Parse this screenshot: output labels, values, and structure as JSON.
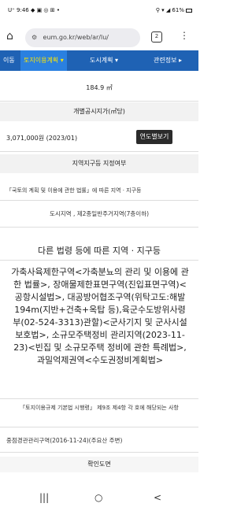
{
  "status": {
    "left": "U⁺ 9:46 ◆ ▣ ◎ ⊞ •",
    "right": "⚲ ▾ ◢ 61%"
  },
  "browser": {
    "url": "eum.go.kr/web/ar/lu/"
  },
  "nav": {
    "prev_label": "이동",
    "active_label": "토지이용계획 ▾",
    "city_label": "도시계획 ▾",
    "related_label": "관련정보 ▸"
  },
  "area": {
    "value": "184.9 ㎡"
  },
  "price": {
    "header": "개별공시지가(㎡당)",
    "value": "3,071,000원 (2023/01)",
    "year_button": "연도별보기"
  },
  "zone": {
    "header": "지역지구등 지정여부",
    "law_note": "「국토의 계획 및 이용에 관한 법률」에 따른 지역 · 지구등",
    "value": "도시지역 , 제2종일반주거지역(7층이하)",
    "other_title": "다른 법령 등에 따른 지역 · 지구등",
    "other_value": "가축사육제한구역<가축분뇨의 관리 및 이용에 관한 법률>, 장애물제한표면구역(진입표면구역)<공항시설법>, 대공방어협조구역(위탁고도:해발194m(지반+건축+옥탑 등),육군수도방위사령부(02-524-3313)관할)<군사기지 및 군사시설 보호법>, 소규모주택정비 관리지역(2023-11-23)<빈집 및 소규모주택 정비에 관한 특례법>, 과밀억제권역<수도권정비계획법>",
    "reg_note": "「토지이용규제 기본법 시행령」 제9조 제4항 각 호에 해당되는 사항",
    "mgmt": "중점경관관리구역(2016-11-24)(주요산 주변)"
  },
  "confirm": {
    "label": "확인도면"
  },
  "bottom": {
    "recent": "|||",
    "home": "○",
    "back": "<"
  }
}
